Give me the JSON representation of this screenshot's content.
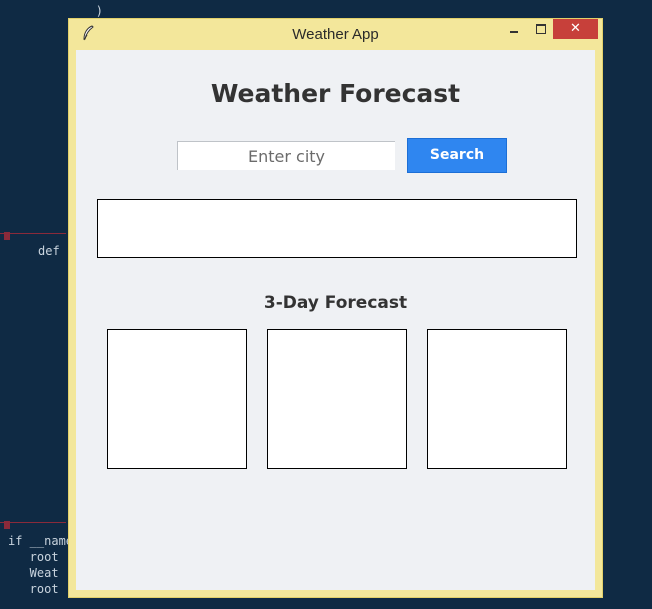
{
  "background_code": {
    "lines": [
      "        )",
      "def",
      "if __name",
      "   root",
      "   Weat",
      "   root"
    ]
  },
  "window": {
    "title": "Weather App",
    "close_symbol": "✕",
    "accent_color": "#f3e79b"
  },
  "main": {
    "heading": "Weather Forecast",
    "search": {
      "placeholder": "Enter city",
      "value": "",
      "button_label": "Search",
      "button_color": "#2f86f0"
    },
    "current_weather": {
      "text": ""
    },
    "forecast": {
      "title": "3-Day Forecast",
      "days": [
        {
          "text": ""
        },
        {
          "text": ""
        },
        {
          "text": ""
        }
      ]
    }
  }
}
